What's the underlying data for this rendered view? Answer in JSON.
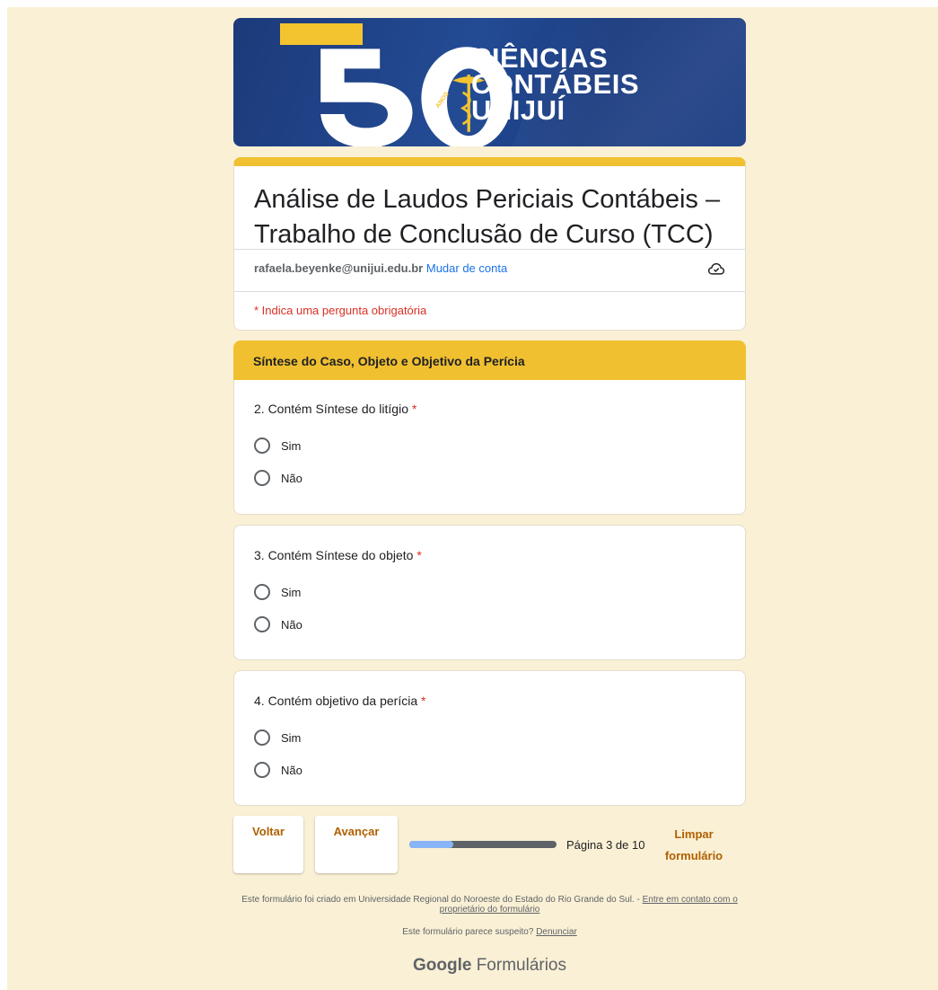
{
  "banner": {
    "line1": "CIÊNCIAS",
    "line2": "CONTÁBEIS",
    "line3": "UNIJUÍ",
    "anos": "ANOS"
  },
  "form": {
    "title": "Análise de Laudos Periciais Contábeis – Trabalho de Conclusão de Curso (TCC)",
    "email": "rafaela.beyenke@unijui.edu.br",
    "switch_account": "Mudar de conta",
    "required_note": "* Indica uma pergunta obrigatória"
  },
  "section": {
    "title": "Síntese do Caso, Objeto e Objetivo da Perícia"
  },
  "questions": [
    {
      "label": "2. Contém Síntese do litígio",
      "star": "*",
      "options": [
        "Sim",
        "Não"
      ]
    },
    {
      "label": "3. Contém Síntese do objeto",
      "star": "*",
      "options": [
        "Sim",
        "Não"
      ]
    },
    {
      "label": "4. Contém objetivo da perícia",
      "star": "*",
      "options": [
        "Sim",
        "Não"
      ]
    }
  ],
  "nav": {
    "back": "Voltar",
    "next": "Avançar",
    "page_label": "Página 3 de 10",
    "progress_fraction": 0.3,
    "clear_line1": "Limpar",
    "clear_line2": "formulário"
  },
  "footer": {
    "created_text": "Este formulário foi criado em Universidade Regional do Noroeste do Estado do Rio Grande do Sul. -",
    "contact_link": "Entre em contato com o proprietário do formulário",
    "suspicious_text": "Este formulário parece suspeito?",
    "report_link": "Denunciar",
    "brand_google": "Google",
    "brand_forms": "Formulários"
  },
  "colors": {
    "background": "#faf0d5",
    "accent": "#f0c030",
    "banner_blue": "#234b94",
    "required_red": "#d93025",
    "link_blue": "#1a73e8",
    "button_text": "#b06000"
  }
}
